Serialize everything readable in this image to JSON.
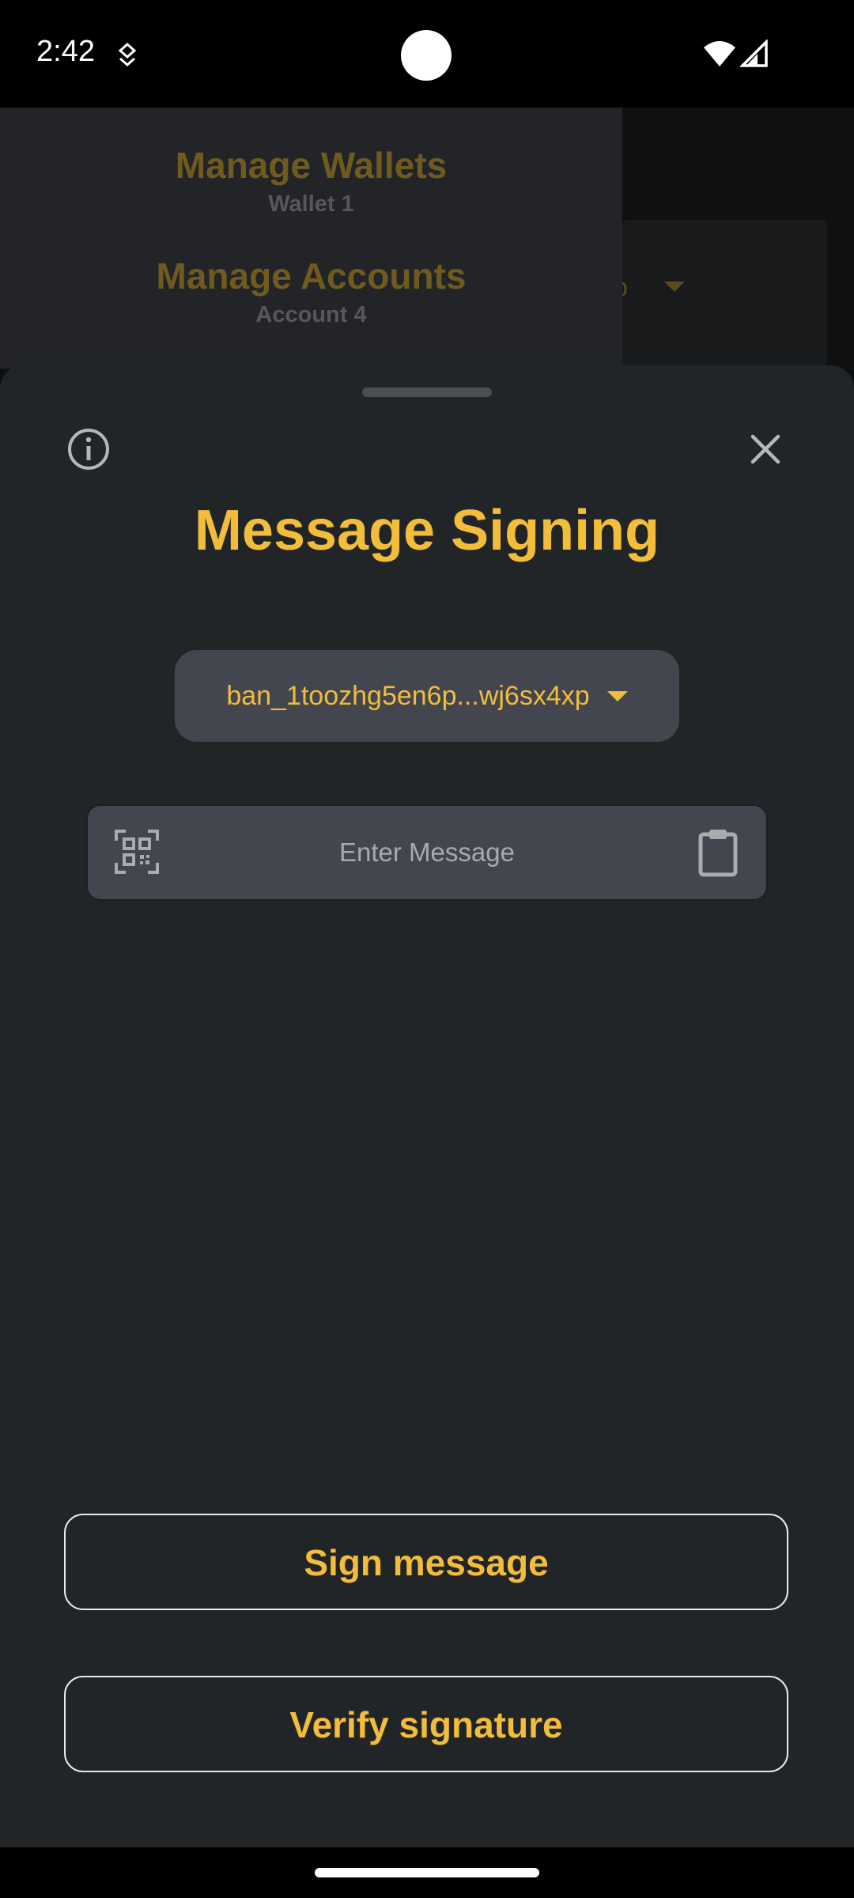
{
  "status_bar": {
    "time": "2:42"
  },
  "background": {
    "address_fragment": "xp"
  },
  "drawer": {
    "items": [
      {
        "title": "Manage Wallets",
        "subtitle": "Wallet 1"
      },
      {
        "title": "Manage Accounts",
        "subtitle": "Account 4"
      }
    ]
  },
  "sheet": {
    "title": "Message Signing",
    "account_select": "ban_1toozhg5en6p...wj6sx4xp",
    "message_placeholder": "Enter Message",
    "sign_label": "Sign message",
    "verify_label": "Verify signature"
  },
  "colors": {
    "accent": "#f2bd3a",
    "sheet_bg": "#222528",
    "field_bg": "#43464e"
  }
}
